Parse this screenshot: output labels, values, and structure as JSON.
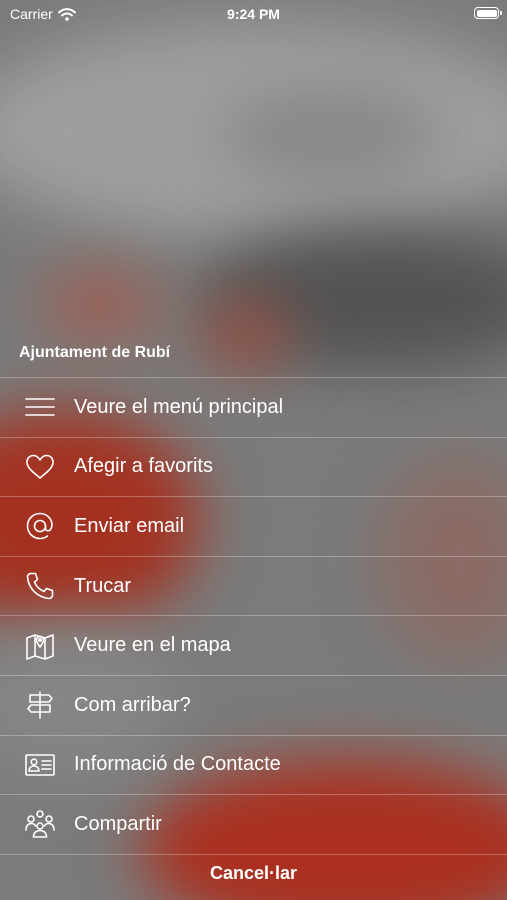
{
  "status_bar": {
    "carrier": "Carrier",
    "time": "9:24 PM"
  },
  "sheet": {
    "title": "Ajuntament de Rubí",
    "items": [
      {
        "label": "Veure el menú principal",
        "icon": "menu-icon"
      },
      {
        "label": "Afegir a favorits",
        "icon": "heart-icon"
      },
      {
        "label": "Enviar email",
        "icon": "at-sign-icon"
      },
      {
        "label": "Trucar",
        "icon": "phone-icon"
      },
      {
        "label": "Veure en el mapa",
        "icon": "map-icon"
      },
      {
        "label": "Com arribar?",
        "icon": "signpost-icon"
      },
      {
        "label": "Informació de Contacte",
        "icon": "contact-card-icon"
      },
      {
        "label": "Compartir",
        "icon": "people-icon"
      }
    ],
    "cancel_label": "Cancel·lar"
  },
  "colors": {
    "accent_red": "#c8321e",
    "text": "#ffffff"
  }
}
